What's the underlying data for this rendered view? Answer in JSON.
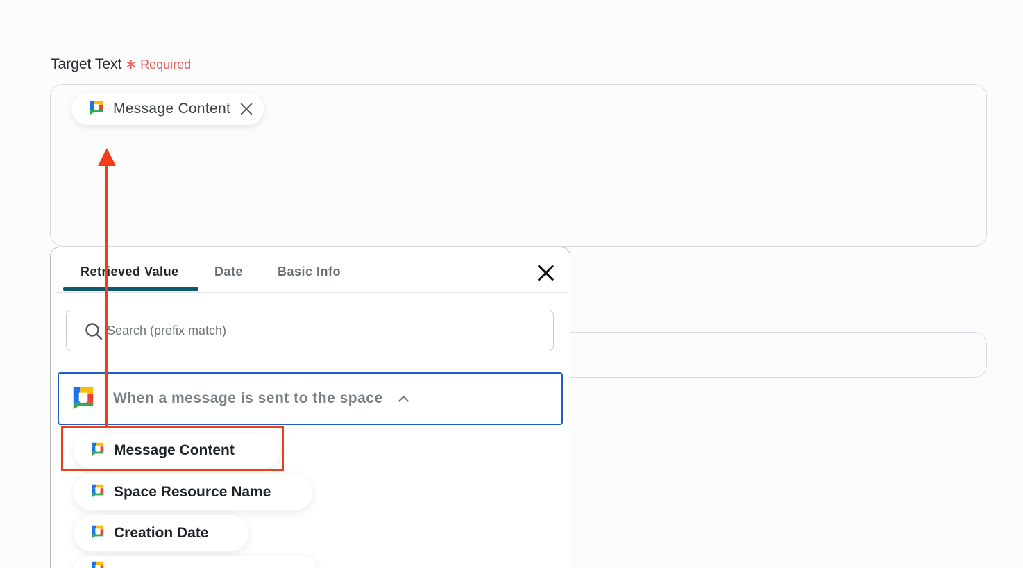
{
  "field": {
    "label": "Target Text",
    "required_star": "∗",
    "required_text": "Required"
  },
  "selected_chip": {
    "label": "Message Content",
    "icon": "google-chat-icon"
  },
  "panel": {
    "tabs": [
      "Retrieved Value",
      "Date",
      "Basic Info"
    ],
    "active_tab": "Retrieved Value",
    "search_placeholder": "Search (prefix match)",
    "group": {
      "label": "When a message is sent to the space",
      "icon": "google-chat-icon",
      "expanded": true
    },
    "items": [
      {
        "label": "Message Content",
        "icon": "google-chat-icon",
        "highlighted": true
      },
      {
        "label": "Space Resource Name",
        "icon": "google-chat-icon"
      },
      {
        "label": "Creation Date",
        "icon": "google-chat-icon"
      },
      {
        "label": "",
        "icon": "google-chat-icon"
      }
    ]
  },
  "colors": {
    "required": "#e95b5b",
    "tab_underline": "#0d5a6e",
    "group_border": "#1f5fc4",
    "annotation": "#f03e1a"
  }
}
